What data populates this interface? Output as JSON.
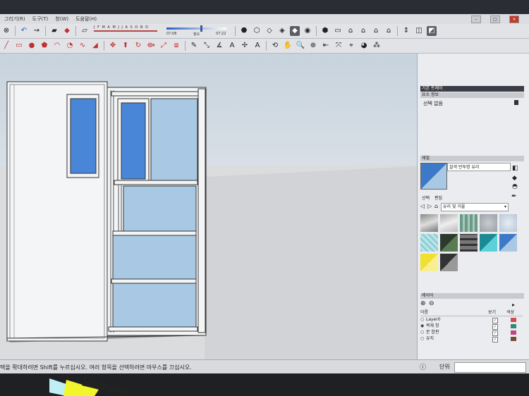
{
  "menu": {
    "items": [
      "그리기(R)",
      "도구(T)",
      "창(W)",
      "도움말(H)"
    ]
  },
  "toolbar": {
    "months": "J F M A M J J A S O N D",
    "time_start": "07:08",
    "time_mid": "정오",
    "time_end": "07:22"
  },
  "panel": {
    "tray_title": "기본 트레이",
    "entity_header": "요소 정보",
    "no_selection": "선택 없음",
    "materials_header": "재질",
    "material_name": "잘색 반투명 유리",
    "tab_select": "선택",
    "tab_edit": "편집",
    "library": "유리 및 거울",
    "layers_header": "레이어",
    "col_name": "이름",
    "col_visible": "보기",
    "col_color": "색상",
    "layers": [
      {
        "name": "Layer0",
        "visible": true,
        "color": "#d44b4b"
      },
      {
        "name": "목재 창",
        "visible": true,
        "color": "#2e8b7a"
      },
      {
        "name": "문 합판",
        "visible": true,
        "color": "#c2487c"
      },
      {
        "name": "유지",
        "visible": true,
        "color": "#7a4a2e"
      }
    ]
  },
  "status": {
    "text": "택을 확대하려면 Shift를 누르십시오. 여러 항목을 선택하려면 마우스를 끄십시오.",
    "unit_label": "단위"
  },
  "colors": {
    "glass_blue": "#4a86d8",
    "glass_light": "#a9c8e3",
    "selection_blue": "#3d79c9"
  }
}
